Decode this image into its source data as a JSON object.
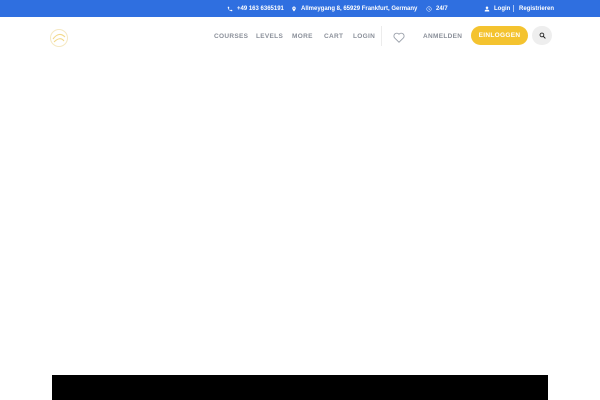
{
  "topbar": {
    "phone": "+49 163 6365191",
    "address": "Allmeygang 8, 65929 Frankfurt, Germany",
    "hours": "24/7",
    "login": "Login",
    "register": "Registrieren",
    "background": "#2f6fe0"
  },
  "header": {
    "logo_icon": "brand-logo-icon",
    "nav": {
      "courses": "COURSES",
      "levels": "LEVELS",
      "more": "MORE",
      "cart": "CART",
      "login": "LOGIN"
    },
    "wishlist_icon": "heart-icon",
    "anmelden": "ANMELDEN",
    "einloggen": "EINLOGGEN",
    "search_icon": "search-icon",
    "accent": "#f4c32f"
  }
}
